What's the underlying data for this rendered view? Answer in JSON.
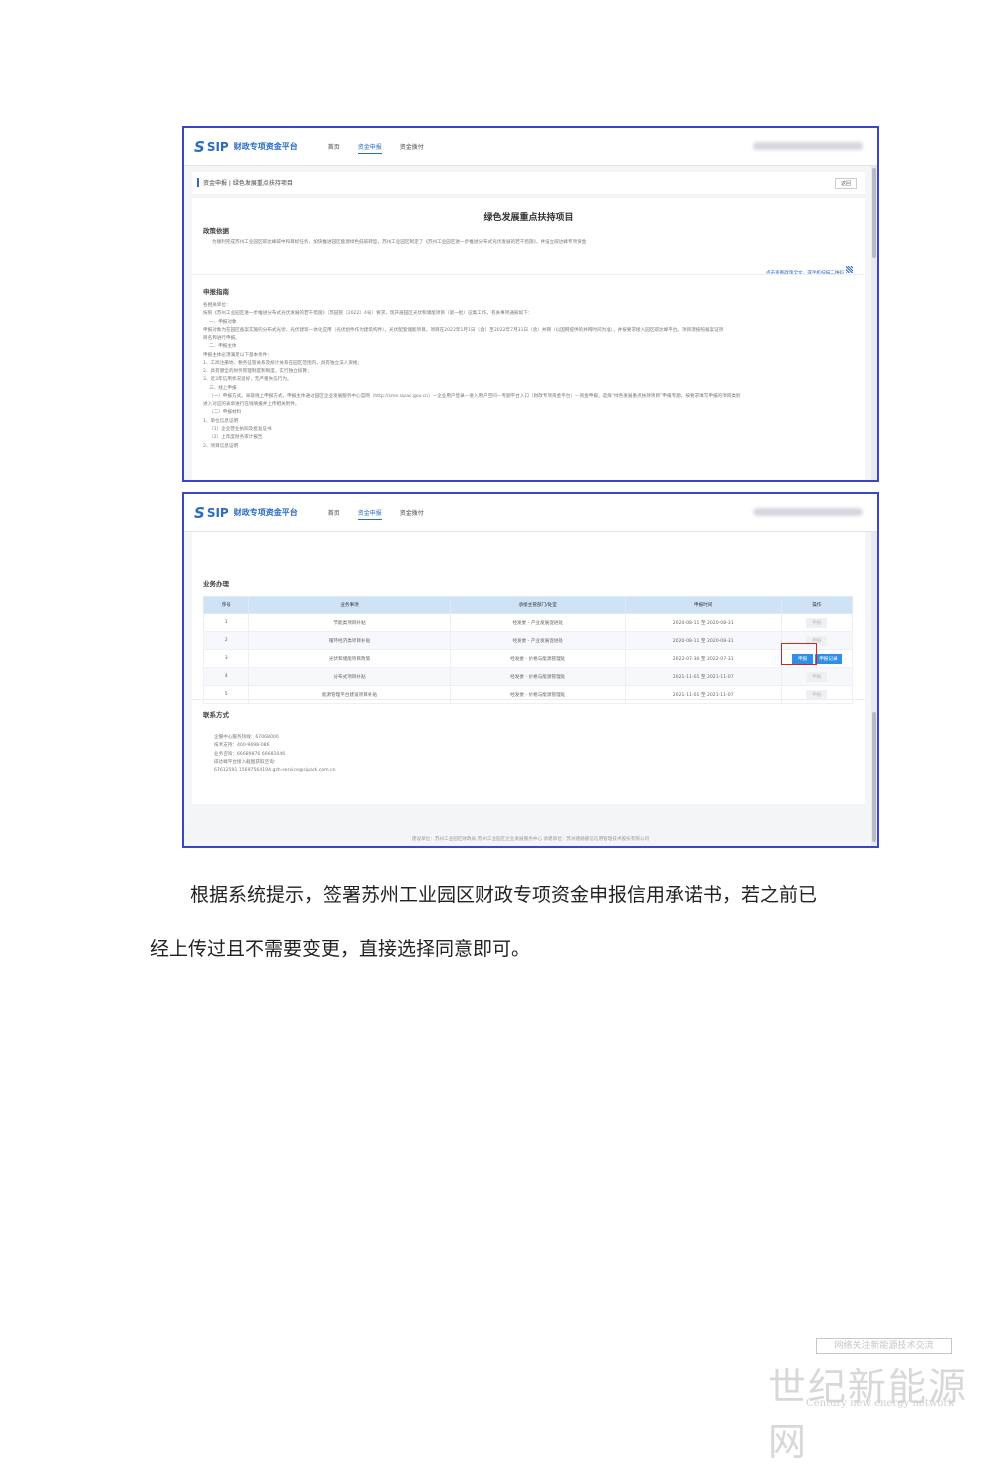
{
  "app": {
    "logo_mark": "S",
    "logo_sip": "SIP",
    "title": "财政专项资金平台",
    "nav": [
      "首页",
      "资金申报",
      "资金拨付"
    ],
    "nav_active": 1
  },
  "screen1": {
    "breadcrumb": "资金申报 | 绿色发展重点扶持项目",
    "back_label": "返回",
    "doc_title": "绿色发展重点扶持项目",
    "policy_heading": "政策依据",
    "policy_text": "为顺利完成苏州工业园区碳达峰碳中和目标任务，加快推进园区能源绿色低碳转型，苏州工业园区制定了《苏州工业园区进一步推进分布式光伏发展的若干措施》，并设立碳达峰专项资金",
    "policy_link": "点击查看政策全文，或手机扫描二维码",
    "guide_heading": "申报指南",
    "guide_lines": [
      "各相关单位：",
      "按照《苏州工业园区进一步推进分布式光伏发展的若干措施》（苏园管〔2022〕4号）要求，现开展园区光伏和储能项目（第一批）征集工作，有关事项通知如下：",
      "一、申报对象",
      "申报对象为在园区备案实施的分布式光伏、光伏建筑一体化应用（光伏组件作为建筑构件），光伏配套储能项目，项目在2022年1月1日（含）至2022年7月31日（含）并网（以国网提供的并网时间为准），并按要求接入园区碳达峰平台。项目须按照备案证项",
      "目名称进行申报。",
      "二、申报主体",
      "申报主体必须满足以下基本条件：",
      "1、工商注册地、税务征管关系及统计关系在园区范围内，具有独立法人资格；",
      "2、具有健全的财务管理制度和制度，实行独立核算；",
      "3、近3年信用状况良好，无严重失信行为。",
      "三、线上申报",
      "（一）申报方式。采取线上申报方式，申报主体通过园区企业发展服务中心官网（http://sme.sipac.gov.cn）—企业用户登录—进入用户空间—专题平台入口（财政专项资金平台）—资金申报，选择“绿色发展重点扶持项目”申报专题，按要求填写申报的项目类别",
      "进入对应的表单进行在线填报并上传相关附件。",
      "（二）申报材料",
      "1、单位信息证明",
      "（1）企业营业执照及批准证书",
      "（2）上年度财务审计报告",
      "2、项目信息证明"
    ]
  },
  "screen2": {
    "section_title": "业务办理",
    "columns": [
      "序号",
      "业务事项",
      "承接主管部门/处室",
      "申报时间",
      "操作"
    ],
    "rows": [
      {
        "no": "1",
        "item": "节能类项目补贴",
        "dept": "经发委 - 产业发展促进处",
        "time": "2020-08-11 至 2020-08-31",
        "op": "申报"
      },
      {
        "no": "2",
        "item": "循环经济类项目补贴",
        "dept": "经发委 - 产业发展促进处",
        "time": "2020-08-11 至 2020-08-31",
        "op": "申报"
      },
      {
        "no": "3",
        "item": "光伏和储能项目政策",
        "dept": "经发委 - 价格与能源管理处",
        "time": "2022-07-30 至 2022-07-31",
        "op": "申报",
        "op2": "申报记录"
      },
      {
        "no": "4",
        "item": "分布式项目补贴",
        "dept": "经发委 - 价格与能源管理处",
        "time": "2021-11-01 至 2021-11-07",
        "op": "申报"
      },
      {
        "no": "5",
        "item": "能源管理平台建设项目补贴",
        "dept": "经发委 - 价格与能源管理处",
        "time": "2021-11-01 至 2021-11-07",
        "op": "申报"
      }
    ],
    "contact_title": "联系方式",
    "contact_lines": [
      "企服中心服务热线：67068000",
      "技术支持：400-9698-086",
      "业务咨询：66689876 66681046",
      "碳达峰平台接入截图获取咨询：",
      "67612591 15697564194 gzh-service@sipark.com.cn"
    ],
    "footer": "建设单位：苏州工业园区财政局 苏州工业园区企业发展服务中心    承建单位：苏州德融嘉信信用管理技术股份有限公司"
  },
  "paragraph": {
    "line1": "根据系统提示，签署苏州工业园区财政专项资金申报信用承诺书，若之前已",
    "line2": "经上传过且不需要变更，直接选择同意即可。"
  },
  "watermark": {
    "tagline": "网络关注新能源技术交流",
    "cn": "世纪新能源网",
    "en": "Century new energy network"
  }
}
